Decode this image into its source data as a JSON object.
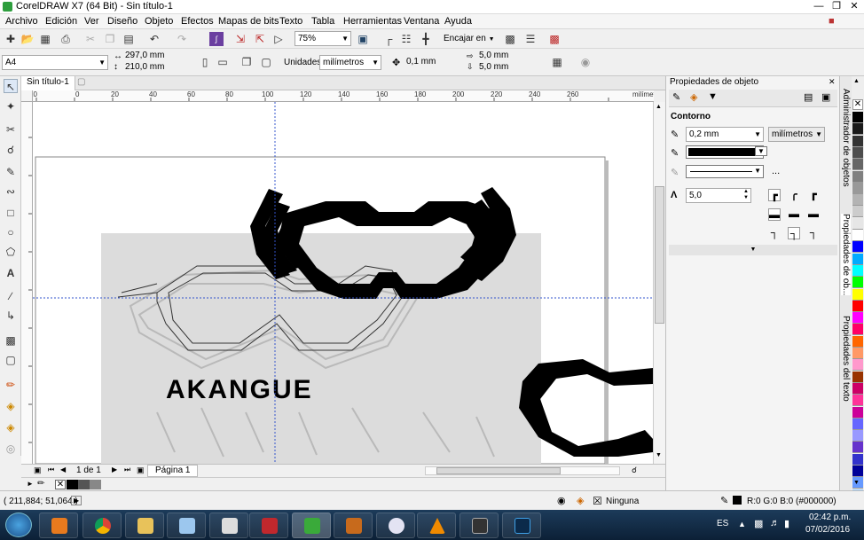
{
  "window": {
    "title": "CorelDRAW X7 (64 Bit) - Sin título-1"
  },
  "menu": [
    "Archivo",
    "Edición",
    "Ver",
    "Diseño",
    "Objeto",
    "Efectos",
    "Mapas de bits",
    "Texto",
    "Tabla",
    "Herramientas",
    "Ventana",
    "Ayuda"
  ],
  "toolbar1": {
    "zoom": "75%",
    "snap": "Encajar en"
  },
  "toolbar2": {
    "page_size": "A4",
    "width": "297,0 mm",
    "height": "210,0 mm",
    "units_label": "Unidades:",
    "units_value": "milímetros",
    "nudge": "0,1 mm",
    "dup_x": "5,0 mm",
    "dup_y": "5,0 mm"
  },
  "doc": {
    "tab": "Sin título-1"
  },
  "ruler": {
    "labels": [
      "20",
      "0",
      "20",
      "40",
      "60",
      "80",
      "100",
      "120",
      "140",
      "160",
      "180",
      "200",
      "220",
      "240",
      "260",
      "280"
    ],
    "unit": "milímetros"
  },
  "canvas": {
    "logo_text": "AKANGUE"
  },
  "page_nav": {
    "current": "1 de 1",
    "page_tab": "Página 1"
  },
  "panel": {
    "title": "Propiedades de objeto",
    "section": "Contorno",
    "width": "0,2 mm",
    "width_units": "milímetros",
    "miter": "5,0",
    "more": "..."
  },
  "dock_tabs": [
    "Administrador de objetos",
    "Propiedades de ob...",
    "Propiedades del texto"
  ],
  "status": {
    "coords": "( 211,884; 51,064 )",
    "outline": "Ninguna",
    "fill_info": "R:0 G:0 B:0 (#000000)"
  },
  "taskbar": {
    "lang": "ES",
    "time": "02:42 p.m.",
    "date": "07/02/2016"
  },
  "palette_colors": [
    "#000000",
    "#1a1a1a",
    "#333333",
    "#4d4d4d",
    "#666666",
    "#808080",
    "#999999",
    "#b3b3b3",
    "#cccccc",
    "#e6e6e6",
    "#ffffff",
    "#0000ff",
    "#00aaff",
    "#00ffff",
    "#00ff00",
    "#ffff00",
    "#ff0000",
    "#ff00ff",
    "#ff0066",
    "#ff6600",
    "#ff9966",
    "#ff99cc",
    "#993300",
    "#cc0066",
    "#ff3399",
    "#cc0099",
    "#6666ff",
    "#9999ff",
    "#6633cc",
    "#3333cc",
    "#000099",
    "#6699ff",
    "#99ccff"
  ]
}
